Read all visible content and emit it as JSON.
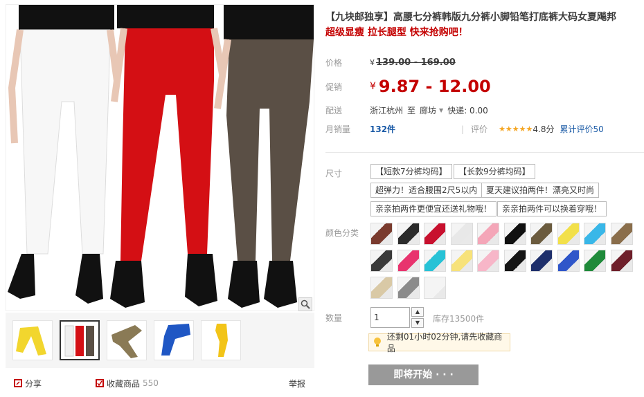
{
  "product": {
    "title": "【九块邮独享】高腰七分裤韩版九分裤小脚铅笔打底裤大码女夏飚邦",
    "subtitle": "超级显瘦 拉长腿型 快来抢购吧！"
  },
  "price": {
    "label": "价格",
    "currency": "¥",
    "original": "139.00 - 169.00"
  },
  "promo": {
    "label": "促销",
    "currency": "¥",
    "value": "9.87 - 12.00"
  },
  "shipping": {
    "label": "配送",
    "from": "浙江杭州",
    "to_word": "至",
    "to": "廊坊",
    "express": "快递: 0.00"
  },
  "sales": {
    "label": "月销量",
    "count": "132件",
    "rating_label": "评价",
    "stars": "★★★★★",
    "score": "4.8分",
    "total_reviews": "累计评价50"
  },
  "sku": {
    "size_label": "尺寸",
    "sizes": [
      "【短款7分裤均码】",
      "【长款9分裤均码】",
      "超弹力！适合腰围2尺5以内",
      "夏天建议拍两件！漂亮又时尚",
      "亲亲拍两件更便宜还送礼物哦！",
      "亲亲拍两件可以换着穿哦！"
    ],
    "color_label": "颜色分类",
    "swatch_colors": [
      [
        "#7a3b2e",
        "#2b2b2b",
        "#c8102e",
        "#e8e8e8",
        "#f4a6b8",
        "#111111",
        "#6b5b3e",
        "#f2e04a",
        "#39b7e8",
        "#8a6e4b"
      ],
      [
        "#3a3a3a",
        "#e8336e",
        "#27c2d6",
        "#f7e27a",
        "#f7b6c8",
        "#151515",
        "#1e2f6b",
        "#2f56c9",
        "#1f8a3a",
        "#6e1f2a"
      ],
      [
        "#d9c9a6",
        "#8b8b8b",
        "#f4f4f4"
      ]
    ]
  },
  "quantity": {
    "label": "数量",
    "value": "1",
    "stock": "库存13500件",
    "up": "▲",
    "down": "▼"
  },
  "tip": {
    "text": "还剩01小时02分钟,请先收藏商品"
  },
  "buy": {
    "label": "即将开始 · · ·"
  },
  "gallery_footer": {
    "share": "分享",
    "favorite": "收藏商品",
    "favorite_count": "550",
    "report": "举报"
  },
  "colors": {
    "accent": "#c40000",
    "pants": [
      "#ffffff",
      "#d40f14",
      "#5a4f45"
    ]
  }
}
